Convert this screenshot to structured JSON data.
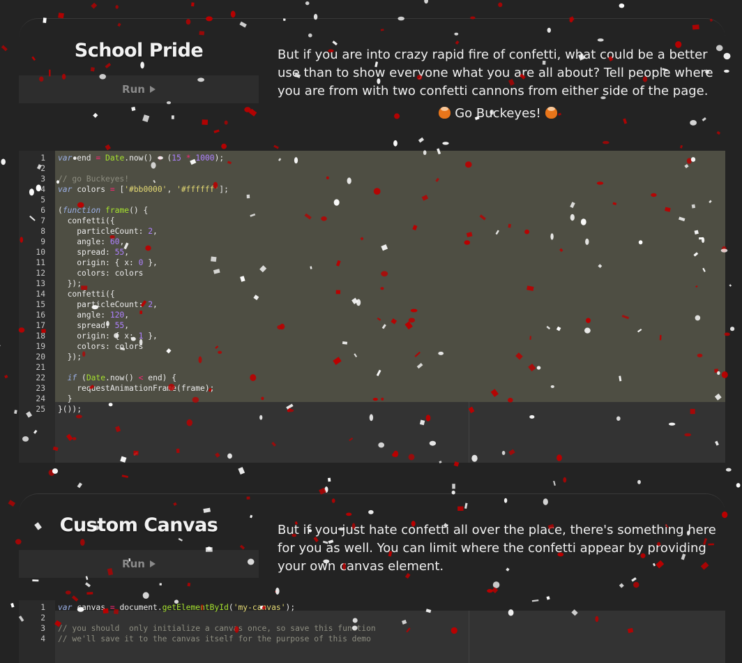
{
  "sections": [
    {
      "title": "School Pride",
      "run_label": "Run",
      "description": "But if you are into crazy rapid fire of confetti, what could be a better use than to show everyone what you are all about? Tell people where you are from with two confetti cannons from either side of the page.",
      "cheer": "Go Buckeyes!",
      "code_lines": [
        "<span class=\"kw\">var</span> end <span class=\"op\">=</span> <span class=\"fn\">Date</span>.now() <span class=\"op\">+</span> (<span class=\"num\">15</span> <span class=\"op\">*</span> <span class=\"num\">1000</span>);",
        "",
        "<span class=\"cm\">// go Buckeyes!</span>",
        "<span class=\"kw\">var</span> colors <span class=\"op\">=</span> [<span class=\"str\">'#bb0000'</span>, <span class=\"str\">'#ffffff'</span>];",
        "",
        "(<span class=\"kw\">function</span> <span class=\"fn\">frame</span>() {",
        "  confetti({",
        "    particleCount: <span class=\"num\">2</span>,",
        "    angle: <span class=\"num\">60</span>,",
        "    spread: <span class=\"num\">55</span>,",
        "    origin: { x: <span class=\"num\">0</span> },",
        "    colors: colors",
        "  });",
        "  confetti({",
        "    particleCount: <span class=\"num\">2</span>,",
        "    angle: <span class=\"num\">120</span>,",
        "    spread: <span class=\"num\">55</span>,",
        "    origin: { x: <span class=\"num\">1</span> },",
        "    colors: colors",
        "  });",
        "",
        "  <span class=\"kw\">if</span> (<span class=\"fn\">Date</span>.now() <span class=\"op\">&lt;</span> end) {",
        "    requestAnimationFrame(frame);",
        "  }",
        "}());"
      ]
    },
    {
      "title": "Custom Canvas",
      "run_label": "Run",
      "description": "But if you just hate confetti all over the place, there's something here for you as well. You can limit where the confetti appear by providing your own canvas element.",
      "code_lines": [
        "<span class=\"kw\">var</span> canvas <span class=\"op\">=</span> document.<span class=\"fn\">getElementById</span>(<span class=\"str\">'my-canvas'</span>);",
        "",
        "<span class=\"cm\">// you should  only initialize a canvas once, so save this function</span>",
        "<span class=\"cm\">// we'll save it to the canvas itself for the purpose of this demo</span>"
      ]
    }
  ],
  "colors": {
    "confetti_red": "#bb0000",
    "confetti_white": "#ffffff",
    "page_background": "#232323"
  }
}
